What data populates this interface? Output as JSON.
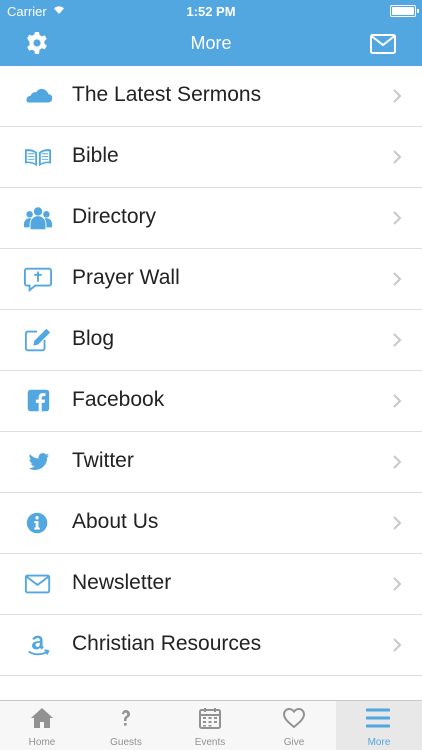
{
  "status_bar": {
    "carrier": "Carrier",
    "time": "1:52 PM"
  },
  "header": {
    "title": "More",
    "accent": "#52a7e0"
  },
  "menu": [
    {
      "label": "The Latest Sermons",
      "icon": "cloud-icon"
    },
    {
      "label": "Bible",
      "icon": "book-icon"
    },
    {
      "label": "Directory",
      "icon": "people-icon"
    },
    {
      "label": " Prayer Wall",
      "icon": "prayer-chat-icon"
    },
    {
      "label": "Blog",
      "icon": "edit-icon"
    },
    {
      "label": "Facebook",
      "icon": "facebook-icon"
    },
    {
      "label": "Twitter",
      "icon": "twitter-icon"
    },
    {
      "label": "About Us",
      "icon": "info-icon"
    },
    {
      "label": "Newsletter",
      "icon": "envelope-icon"
    },
    {
      "label": "Christian Resources",
      "icon": "amazon-icon"
    }
  ],
  "tabs": [
    {
      "label": "Home",
      "icon": "home-icon"
    },
    {
      "label": "Guests",
      "icon": "question-icon"
    },
    {
      "label": "Events",
      "icon": "calendar-icon"
    },
    {
      "label": "Give",
      "icon": "heart-icon"
    },
    {
      "label": "More",
      "icon": "menu-icon",
      "active": true
    }
  ]
}
